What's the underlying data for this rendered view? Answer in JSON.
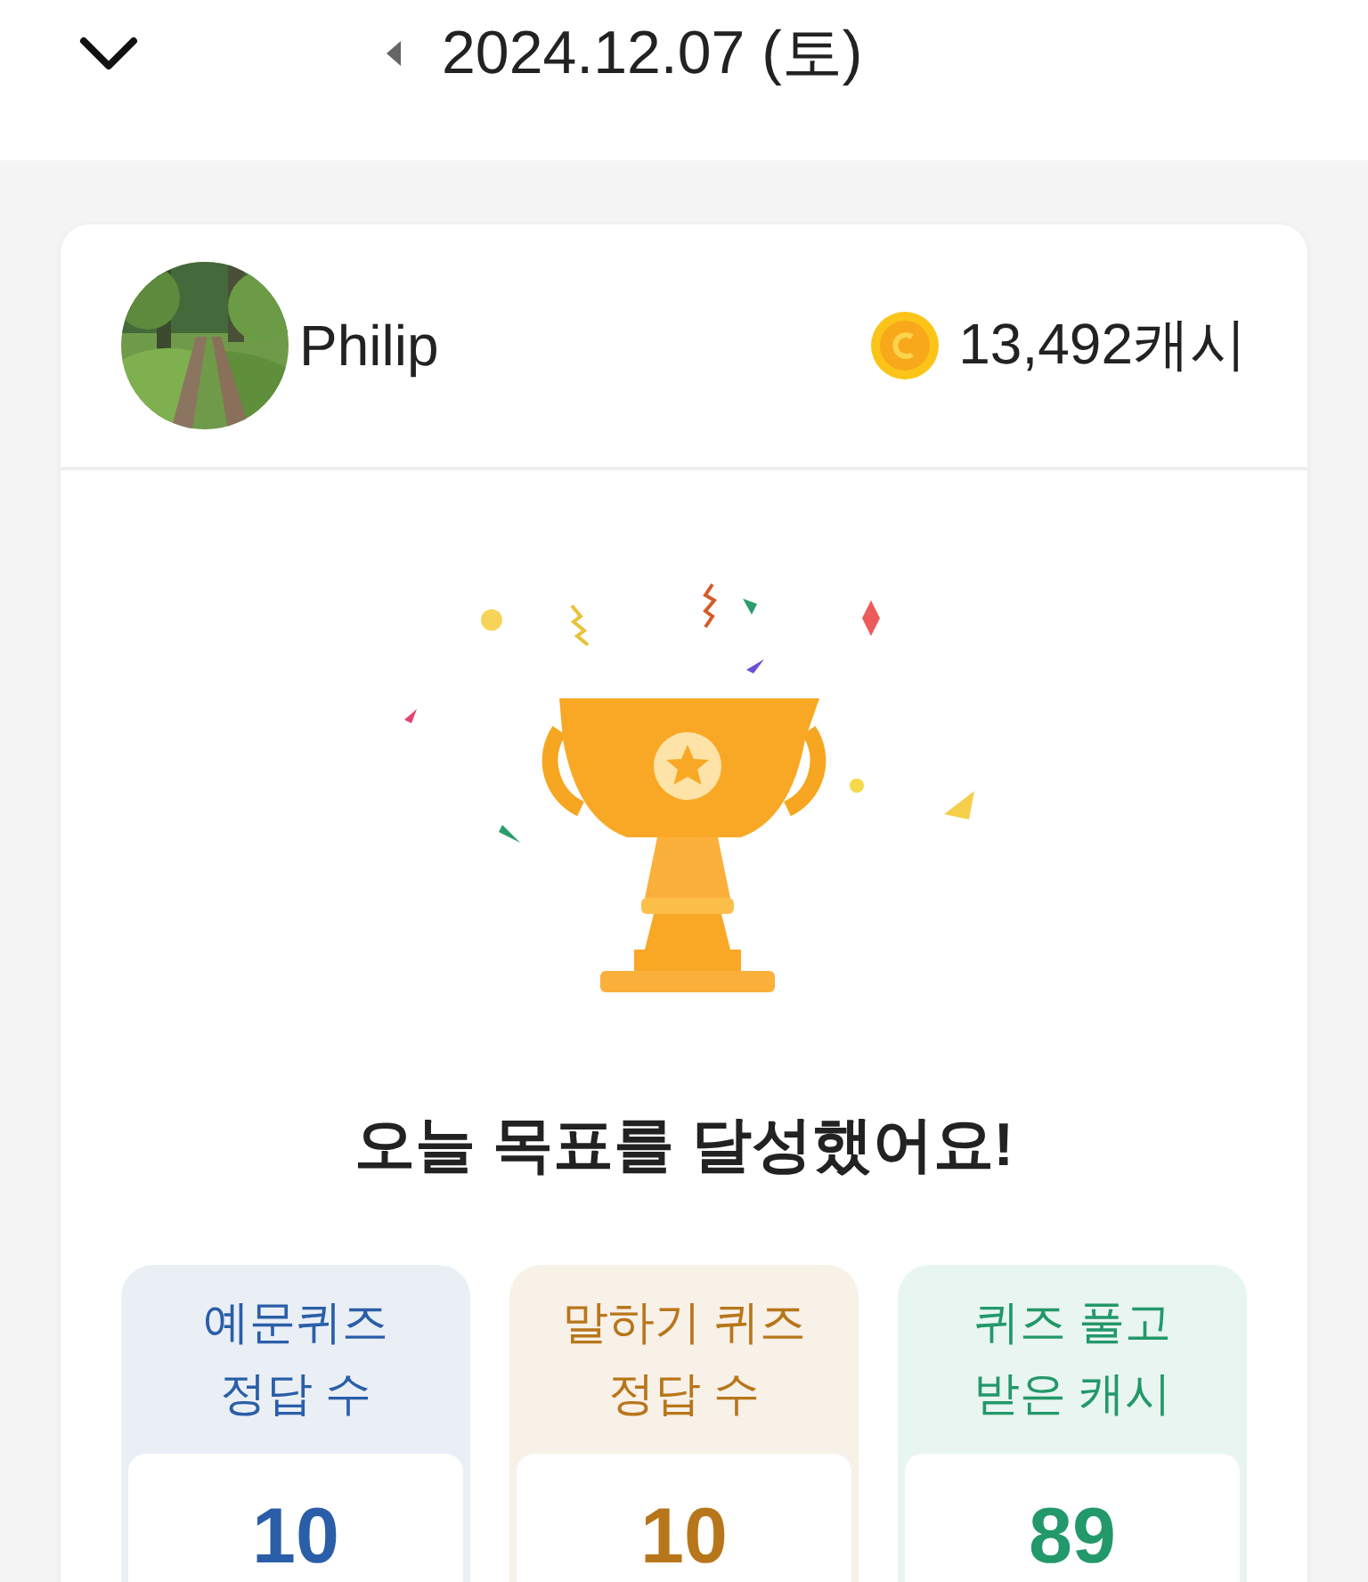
{
  "header": {
    "date": "2024.12.07 (토)"
  },
  "profile": {
    "name": "Philip",
    "cash": "13,492캐시"
  },
  "result": {
    "title": "오늘 목표를 달성했어요!"
  },
  "stats": [
    {
      "label": "예문퀴즈\n정답 수",
      "value": "10",
      "color": "#2a5ea8"
    },
    {
      "label": "말하기 퀴즈\n정답 수",
      "value": "10",
      "color": "#b8761a"
    },
    {
      "label": "퀴즈 풀고\n받은 캐시",
      "value": "89",
      "color": "#23986a"
    }
  ]
}
